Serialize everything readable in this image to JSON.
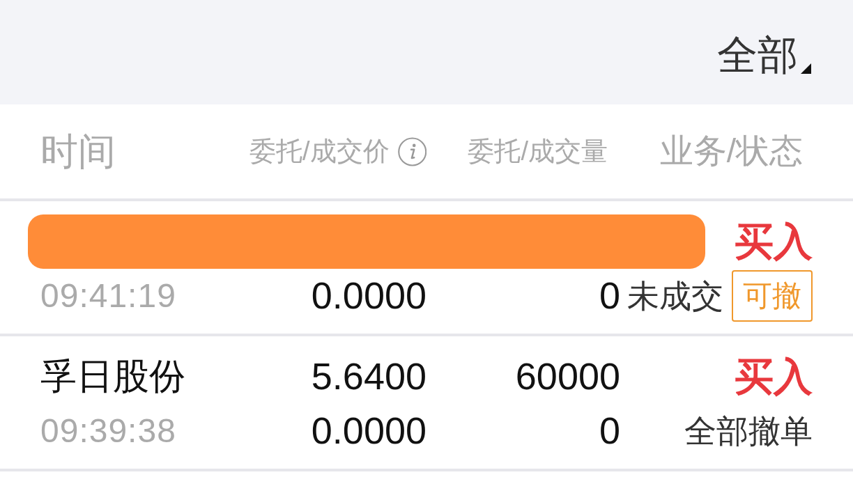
{
  "filter": {
    "label": "全部"
  },
  "columns": [
    {
      "label": "时间",
      "info": false
    },
    {
      "label": "委托/成交价",
      "info": true
    },
    {
      "label": "委托/成交量",
      "info": false
    },
    {
      "label": "业务/状态",
      "info": false
    }
  ],
  "orders": [
    {
      "redacted": true,
      "side": {
        "label": "买入",
        "kind": "buy"
      },
      "time": "09:41:19",
      "deal_price": "0.0000",
      "deal_quantity": "0",
      "status": "未成交",
      "action": "可撤"
    },
    {
      "redacted": false,
      "name": "孚日股份",
      "price": "5.6400",
      "quantity": "60000",
      "side": {
        "label": "买入",
        "kind": "buy"
      },
      "time": "09:39:38",
      "deal_price": "0.0000",
      "deal_quantity": "0",
      "status": "全部撤单"
    }
  ]
}
